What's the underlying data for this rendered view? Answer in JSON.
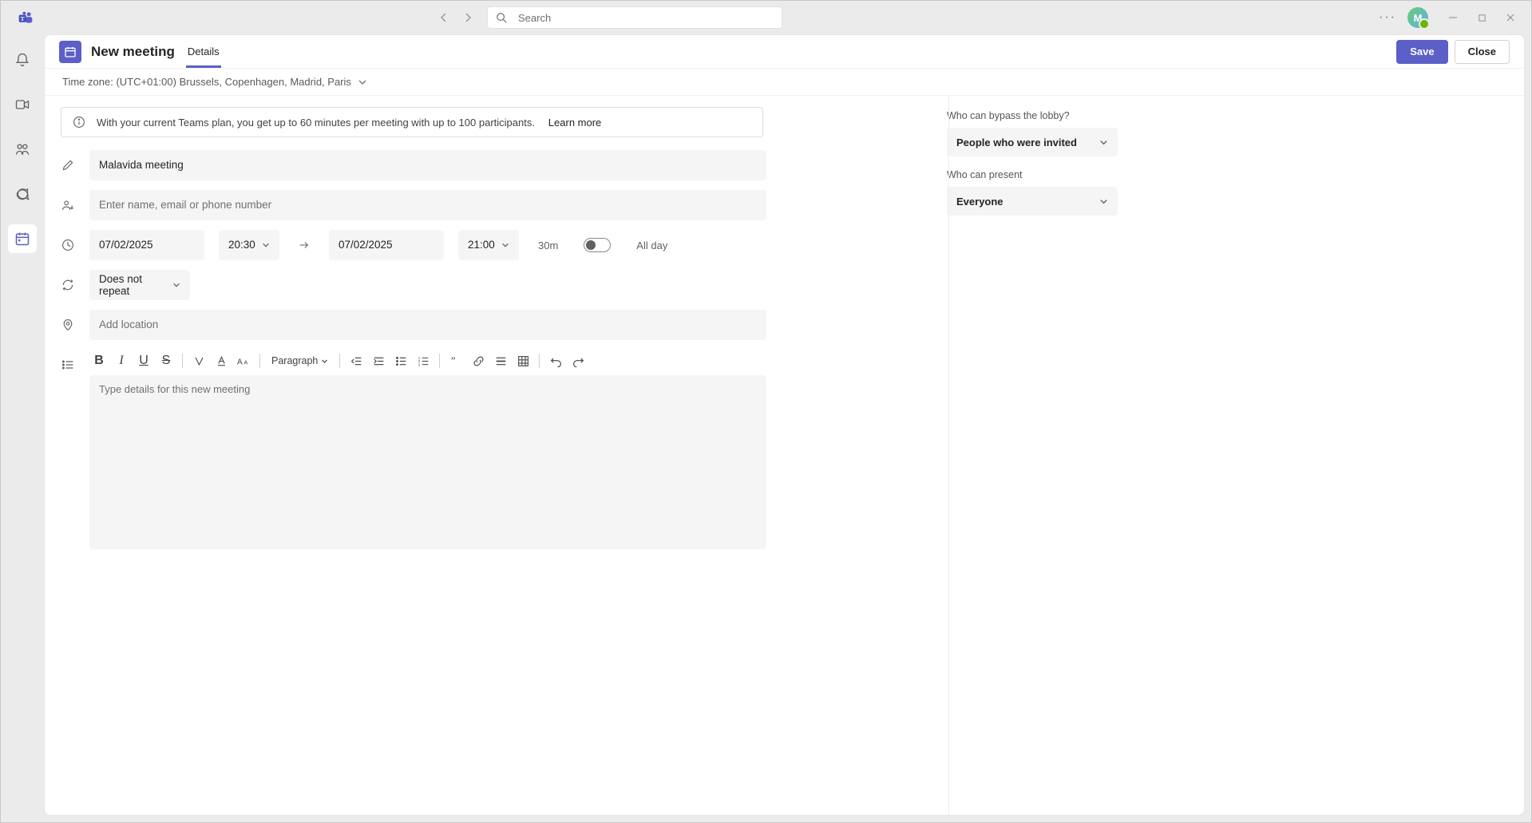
{
  "search": {
    "placeholder": "Search"
  },
  "header": {
    "title": "New meeting",
    "tab_details": "Details",
    "save": "Save",
    "close": "Close"
  },
  "timezone": {
    "label_prefix": "Time zone:",
    "value": "(UTC+01:00) Brussels, Copenhagen, Madrid, Paris"
  },
  "banner": {
    "text": "With your current Teams plan, you get up to 60 minutes per meeting with up to 100 participants.",
    "learn_more": "Learn more"
  },
  "form": {
    "title_value": "Malavida meeting",
    "attendees_placeholder": "Enter name, email or phone number",
    "start_date": "07/02/2025",
    "start_time": "20:30",
    "end_date": "07/02/2025",
    "end_time": "21:00",
    "duration": "30m",
    "all_day": "All day",
    "repeat": "Does not repeat",
    "location_placeholder": "Add location",
    "paragraph_label": "Paragraph",
    "details_placeholder": "Type details for this new meeting"
  },
  "side": {
    "bypass_label": "Who can bypass the lobby?",
    "bypass_value": "People who were invited",
    "present_label": "Who can present",
    "present_value": "Everyone"
  },
  "avatar_initial": "M"
}
